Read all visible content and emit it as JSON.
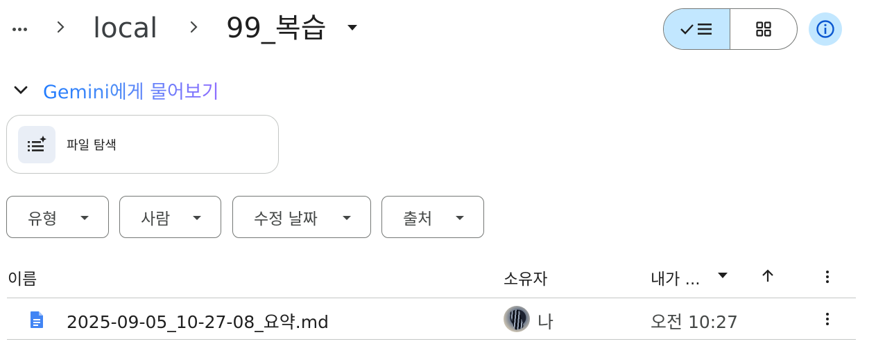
{
  "breadcrumb": {
    "parent": "local",
    "current": "99_복습"
  },
  "gemini": {
    "label_brand": "Gemini",
    "label_rest": "에게 물어보기"
  },
  "file_search": {
    "label": "파일 탐색"
  },
  "filters": [
    {
      "label": "유형"
    },
    {
      "label": "사람"
    },
    {
      "label": "수정 날짜"
    },
    {
      "label": "출처"
    }
  ],
  "table": {
    "columns": {
      "name": "이름",
      "owner": "소유자",
      "modified": "내가 ..."
    },
    "rows": [
      {
        "name": "2025-09-05_10-27-08_요약.md",
        "owner": "나",
        "modified": "오전 10:27"
      }
    ]
  },
  "icons": {
    "more": "more-horiz-icon",
    "chevron": "chevron-right-icon",
    "dropdown": "arrow-drop-down-icon",
    "list_view": "check-list-view-icon",
    "grid_view": "grid-view-icon",
    "info": "info-icon",
    "sort": "arrow-upward-icon",
    "file": "document-icon"
  },
  "colors": {
    "accent_selected": "#c2e7ff",
    "doc_blue": "#4285f4",
    "gemini_blue": "#217bfe",
    "gemini_purple": "#8e6dff"
  }
}
